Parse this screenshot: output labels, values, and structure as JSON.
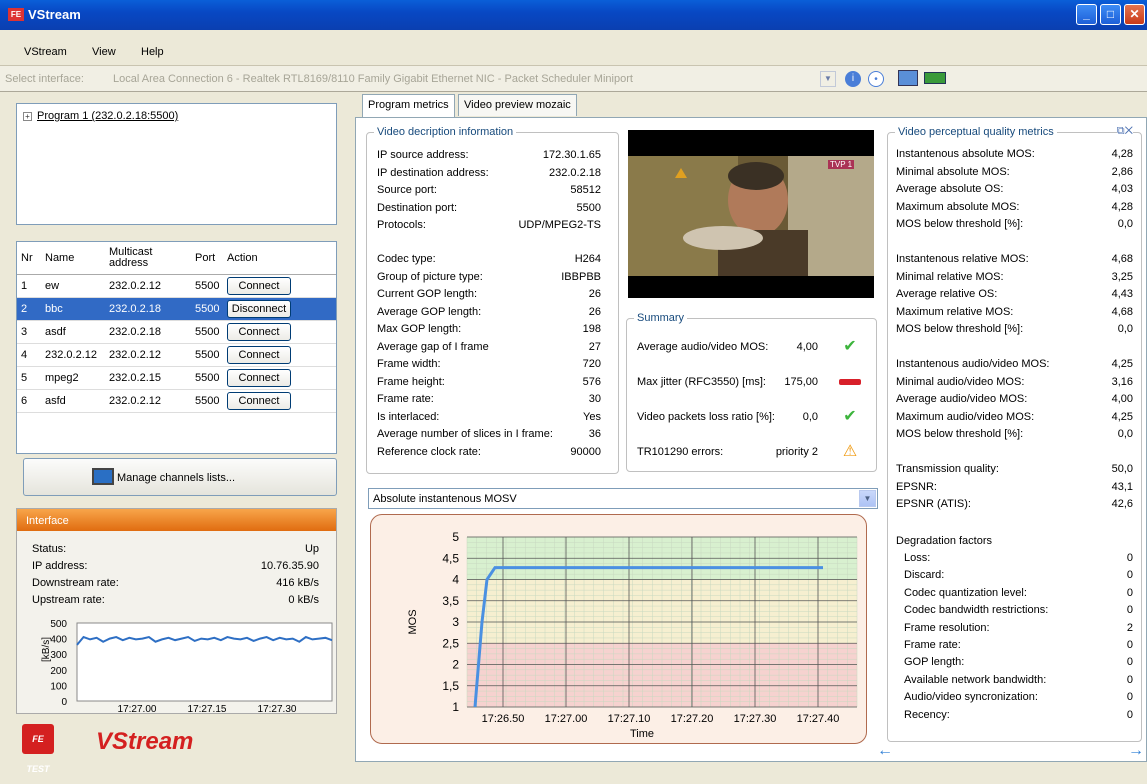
{
  "window": {
    "title": "VStream",
    "logo_text": "FE",
    "btn_min": "_",
    "btn_max": "□",
    "btn_close": "✕"
  },
  "menu": [
    "VStream",
    "View",
    "Help"
  ],
  "interface": {
    "label": "Select interface:",
    "value": "Local Area Connection 6 - Realtek RTL8169/8110 Family Gigabit Ethernet NIC - Packet Scheduler Miniport"
  },
  "tree": {
    "expander": "+",
    "item": "Program 1 (232.0.2.18:5500)"
  },
  "channels": {
    "headers": {
      "nr": "Nr",
      "name": "Name",
      "multicast": "Multicast address",
      "port": "Port",
      "action": "Action"
    },
    "rows": [
      {
        "nr": "1",
        "name": "ew",
        "addr": "232.0.2.12",
        "port": "5500",
        "action": "Connect"
      },
      {
        "nr": "2",
        "name": "bbc",
        "addr": "232.0.2.18",
        "port": "5500",
        "action": "Disconnect",
        "selected": true
      },
      {
        "nr": "3",
        "name": "asdf",
        "addr": "232.0.2.18",
        "port": "5500",
        "action": "Connect"
      },
      {
        "nr": "4",
        "name": "232.0.2.12",
        "addr": "232.0.2.12",
        "port": "5500",
        "action": "Connect"
      },
      {
        "nr": "5",
        "name": "mpeg2",
        "addr": "232.0.2.15",
        "port": "5500",
        "action": "Connect"
      },
      {
        "nr": "6",
        "name": "asfd",
        "addr": "232.0.2.12",
        "port": "5500",
        "action": "Connect"
      }
    ],
    "manage_label": "Manage channels lists..."
  },
  "iface_panel": {
    "header": "Interface",
    "rows": [
      {
        "label": "Status:",
        "value": "Up"
      },
      {
        "label": "IP address:",
        "value": "10.76.35.90"
      },
      {
        "label": "Downstream rate:",
        "value": "416 kB/s"
      },
      {
        "label": "Upstream rate:",
        "value": "0 kB/s"
      }
    ],
    "chart": {
      "ylabel": "[kB/s]",
      "yticks": [
        "500",
        "400",
        "300",
        "200",
        "100",
        "0"
      ],
      "xticks": [
        "17:27.00",
        "17:27.15",
        "17:27.30"
      ]
    }
  },
  "brand": {
    "logo": "FE TEST",
    "name": "VStream"
  },
  "tabs": [
    "Program metrics",
    "Video preview mozaic"
  ],
  "video_info": {
    "title": "Video decription information",
    "rows1": [
      {
        "label": "IP source address:",
        "value": "172.30.1.65"
      },
      {
        "label": "IP destination address:",
        "value": "232.0.2.18"
      },
      {
        "label": "Source port:",
        "value": "58512"
      },
      {
        "label": "Destination port:",
        "value": "5500"
      },
      {
        "label": "Protocols:",
        "value": "UDP/MPEG2-TS"
      }
    ],
    "rows2": [
      {
        "label": "Codec type:",
        "value": "H264"
      },
      {
        "label": "Group of picture type:",
        "value": "IBBPBB"
      },
      {
        "label": "Current GOP length:",
        "value": "26"
      },
      {
        "label": "Average GOP length:",
        "value": "26"
      },
      {
        "label": "Max GOP length:",
        "value": "198"
      },
      {
        "label": "Average gap of I frame",
        "value": "27"
      },
      {
        "label": "Frame width:",
        "value": "720"
      },
      {
        "label": "Frame height:",
        "value": "576"
      },
      {
        "label": "Frame rate:",
        "value": "30"
      },
      {
        "label": "Is interlaced:",
        "value": "Yes"
      },
      {
        "label": "Average number of slices in I frame:",
        "value": "36"
      },
      {
        "label": "Reference clock rate:",
        "value": "90000"
      }
    ]
  },
  "video_overlay": "TVP 1",
  "summary": {
    "title": "Summary",
    "rows": [
      {
        "label": "Average audio/video MOS:",
        "value": "4,00",
        "status": "ok"
      },
      {
        "label": "Max jitter (RFC3550) [ms]:",
        "value": "175,00",
        "status": "bad"
      },
      {
        "label": "Video packets loss ratio [%]:",
        "value": "0,0",
        "status": "ok"
      },
      {
        "label": "TR101290 errors:",
        "value": "priority 2",
        "status": "warn"
      }
    ]
  },
  "quality": {
    "title": "Video perceptual quality metrics",
    "sections": [
      [
        {
          "label": "Instantenous absolute MOS:",
          "value": "4,28"
        },
        {
          "label": "Minimal absolute MOS:",
          "value": "2,86"
        },
        {
          "label": "Average absolute OS:",
          "value": "4,03"
        },
        {
          "label": "Maximum absolute MOS:",
          "value": "4,28"
        },
        {
          "label": "MOS below threshold [%]:",
          "value": "0,0"
        }
      ],
      [
        {
          "label": "Instantenous relative MOS:",
          "value": "4,68"
        },
        {
          "label": "Minimal relative MOS:",
          "value": "3,25"
        },
        {
          "label": "Average relative OS:",
          "value": "4,43"
        },
        {
          "label": "Maximum relative MOS:",
          "value": "4,68"
        },
        {
          "label": "MOS below threshold [%]:",
          "value": "0,0"
        }
      ],
      [
        {
          "label": "Instantenous audio/video MOS:",
          "value": "4,25"
        },
        {
          "label": "Minimal audio/video MOS:",
          "value": "3,16"
        },
        {
          "label": "Average audio/video MOS:",
          "value": "4,00"
        },
        {
          "label": "Maximum audio/video MOS:",
          "value": "4,25"
        },
        {
          "label": "MOS below threshold [%]:",
          "value": "0,0"
        }
      ],
      [
        {
          "label": "Transmission quality:",
          "value": "50,0"
        },
        {
          "label": "EPSNR:",
          "value": "43,1"
        },
        {
          "label": "EPSNR (ATIS):",
          "value": "42,6"
        }
      ]
    ],
    "degradation_title": "Degradation factors",
    "degradation": [
      {
        "label": "Loss:",
        "value": "0"
      },
      {
        "label": "Discard:",
        "value": "0"
      },
      {
        "label": "Codec quantization level:",
        "value": "0"
      },
      {
        "label": "Codec bandwidth restrictions:",
        "value": "0"
      },
      {
        "label": "Frame resolution:",
        "value": "2"
      },
      {
        "label": "Frame rate:",
        "value": "0"
      },
      {
        "label": "GOP length:",
        "value": "0"
      },
      {
        "label": "Available network bandwidth:",
        "value": "0"
      },
      {
        "label": "Audio/video syncronization:",
        "value": "0"
      },
      {
        "label": "Recency:",
        "value": "0"
      }
    ]
  },
  "dropdown": {
    "value": "Absolute instantenous MOSV"
  },
  "chart_data": {
    "type": "line",
    "title": "",
    "xlabel": "Time",
    "ylabel": "MOS",
    "ylim": [
      1,
      5
    ],
    "yticks": [
      "1",
      "1,5",
      "2",
      "2,5",
      "3",
      "3,5",
      "4",
      "4,5",
      "5"
    ],
    "xticks": [
      "17:26.50",
      "17:27.00",
      "17:27.10",
      "17:27.20",
      "17:27.30",
      "17:27.40"
    ],
    "series": [
      {
        "x": [
          "17:26.45",
          "17:26.46",
          "17:26.47",
          "17:26.48",
          "17:26.50",
          "17:27.00",
          "17:27.20",
          "17:27.40"
        ],
        "values": [
          1.0,
          3.0,
          4.0,
          4.28,
          4.28,
          4.28,
          4.28,
          4.28
        ]
      }
    ],
    "grid": true,
    "band_colors": {
      "good": "#d8f0cf",
      "mid": "#f6efd0",
      "bad": "#f6d2cf"
    }
  },
  "mini_chart_data": {
    "type": "line",
    "ylim": [
      0,
      500
    ],
    "values": [
      360,
      410,
      395,
      405,
      380,
      400,
      410,
      390,
      405,
      395,
      400,
      410,
      380,
      395,
      405,
      390,
      400,
      410,
      385,
      400,
      395,
      405,
      390,
      410,
      400,
      395,
      405,
      385,
      400,
      410,
      390,
      405,
      395,
      400,
      380,
      410,
      395,
      400,
      405,
      390
    ]
  },
  "colors": {
    "accent": "#316ac5",
    "title": "#0a5fd8",
    "header_orange": "#e06c10",
    "brand_red": "#d42020"
  }
}
